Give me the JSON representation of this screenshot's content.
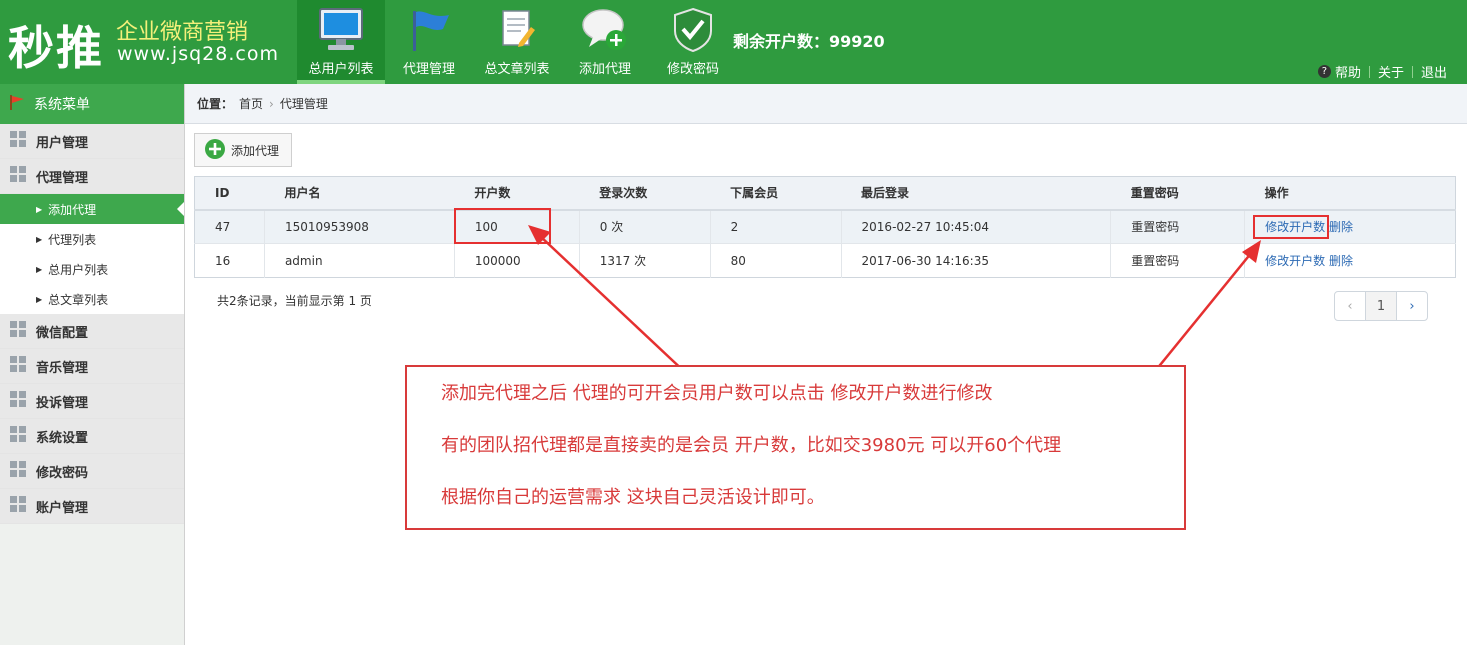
{
  "logo": {
    "main": "秒推",
    "sub": "企业微商营销",
    "url": "www.jsq28.com"
  },
  "nav": [
    {
      "label": "总用户列表",
      "icon": "monitor-icon",
      "active": true
    },
    {
      "label": "代理管理",
      "icon": "flag-icon"
    },
    {
      "label": "总文章列表",
      "icon": "document-edit-icon"
    },
    {
      "label": "添加代理",
      "icon": "chat-add-icon"
    },
    {
      "label": "修改密码",
      "icon": "shield-check-icon"
    }
  ],
  "remaining_label": "剩余开户数：99920",
  "top_links": {
    "help": "帮助",
    "about": "关于",
    "logout": "退出"
  },
  "sidebar": {
    "title": "系统菜单",
    "menu": [
      {
        "label": "用户管理"
      },
      {
        "label": "代理管理",
        "subs": [
          "添加代理",
          "代理列表",
          "总用户列表",
          "总文章列表"
        ]
      },
      {
        "label": "微信配置"
      },
      {
        "label": "音乐管理"
      },
      {
        "label": "投诉管理"
      },
      {
        "label": "系统设置"
      },
      {
        "label": "修改密码"
      },
      {
        "label": "账户管理"
      }
    ]
  },
  "breadcrumb": {
    "label": "位置：",
    "home": "首页",
    "current": "代理管理"
  },
  "add_button": "添加代理",
  "table": {
    "headers": [
      "ID",
      "用户名",
      "开户数",
      "登录次数",
      "下属会员",
      "最后登录",
      "重置密码",
      "操作"
    ],
    "rows": [
      {
        "id": "47",
        "username": "15010953908",
        "accounts": "100",
        "logins": "0 次",
        "members": "2",
        "last_login": "2016-02-27 10:45:04",
        "reset": "重置密码",
        "op_edit": "修改开户数",
        "op_delete": "删除"
      },
      {
        "id": "16",
        "username": "admin",
        "accounts": "100000",
        "logins": "1317 次",
        "members": "80",
        "last_login": "2017-06-30 14:16:35",
        "reset": "重置密码",
        "op_edit": "修改开户数",
        "op_delete": "删除"
      }
    ]
  },
  "records": "共2条记录，当前显示第 1 页",
  "pager": {
    "prev": "‹",
    "current": "1",
    "next": "›"
  },
  "note": {
    "line1": "添加完代理之后 代理的可开会员用户数可以点击 修改开户数进行修改",
    "line2": "有的团队招代理都是直接卖的是会员 开户数，比如交3980元 可以开60个代理",
    "line3": "根据你自己的运营需求 这块自己灵活设计即可。"
  },
  "colors": {
    "header_green": "#2f9b3f",
    "annotation_red": "#e53030",
    "link_blue": "#2c6ab4"
  }
}
